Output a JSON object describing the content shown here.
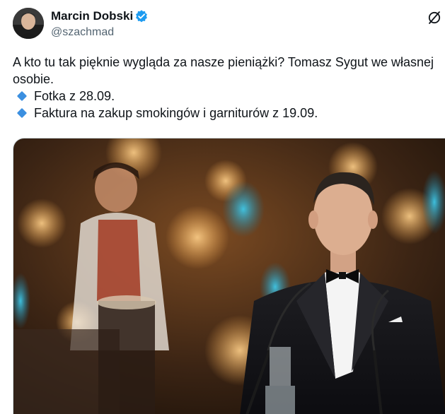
{
  "author": {
    "name": "Marcin Dobski",
    "handle": "@szachmad",
    "verified": true
  },
  "tweet": {
    "text_line1": "A kto tu tak pięknie wygląda za nasze pieniążki? Tomasz Sygut we własnej osobie.",
    "bullets": [
      "Fotka z 28.09.",
      "Faktura na zakup smokingów i garniturów z 19.09."
    ]
  },
  "icons": {
    "verified": "verified-badge-icon",
    "grok": "grok-icon",
    "bullet": "small-blue-diamond-icon"
  },
  "colors": {
    "text": "#0f1419",
    "secondary": "#536471",
    "verified_blue": "#1d9bf0",
    "bullet_blue": "#3b8fe0"
  }
}
